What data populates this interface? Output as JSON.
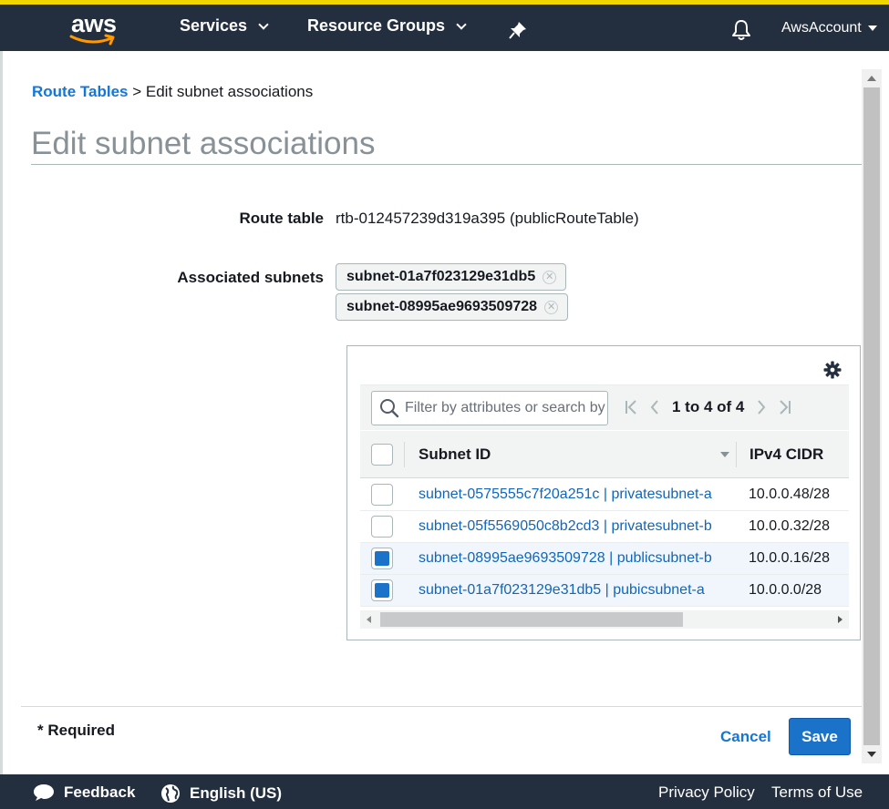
{
  "nav": {
    "logo_text": "aws",
    "services_label": "Services",
    "resource_groups_label": "Resource Groups",
    "account_label": "AwsAccount"
  },
  "breadcrumb": {
    "parent_label": "Route Tables",
    "separator": ">",
    "current_label": "Edit subnet associations"
  },
  "page": {
    "title": "Edit subnet associations"
  },
  "form": {
    "route_table_label": "Route table",
    "route_table_value": "rtb-012457239d319a395 (publicRouteTable)",
    "associated_subnets_label": "Associated subnets",
    "associated_subnets": [
      "subnet-01a7f023129e31db5",
      "subnet-08995ae9693509728"
    ]
  },
  "table": {
    "filter_placeholder": "Filter by attributes or search by keyword",
    "pagination_text": "1 to 4 of 4",
    "columns": [
      "Subnet ID",
      "IPv4 CIDR"
    ],
    "rows": [
      {
        "subnet": "subnet-0575555c7f20a251c | privatesubnet-a",
        "cidr": "10.0.0.48/28",
        "checked": false
      },
      {
        "subnet": "subnet-05f5569050c8b2cd3 | privatesubnet-b",
        "cidr": "10.0.0.32/28",
        "checked": false
      },
      {
        "subnet": "subnet-08995ae9693509728 | publicsubnet-b",
        "cidr": "10.0.0.16/28",
        "checked": true
      },
      {
        "subnet": "subnet-01a7f023129e31db5 | pubicsubnet-a",
        "cidr": "10.0.0.0/28",
        "checked": true
      }
    ]
  },
  "footer": {
    "required_note": "* Required",
    "cancel_label": "Cancel",
    "save_label": "Save"
  },
  "bottom_bar": {
    "feedback_label": "Feedback",
    "language_label": "English (US)",
    "privacy_label": "Privacy Policy",
    "terms_label": "Terms of Use"
  },
  "colors": {
    "nav_bg": "#232f3e",
    "nav_accent": "#f2d600",
    "link": "#1477d4",
    "primary_button": "#1a73c8"
  },
  "icons": [
    "aws-logo-icon",
    "pin-icon",
    "bell-icon",
    "search-icon",
    "gear-icon",
    "first-page-icon",
    "prev-page-icon",
    "next-page-icon",
    "last-page-icon",
    "feedback-icon",
    "globe-icon"
  ]
}
